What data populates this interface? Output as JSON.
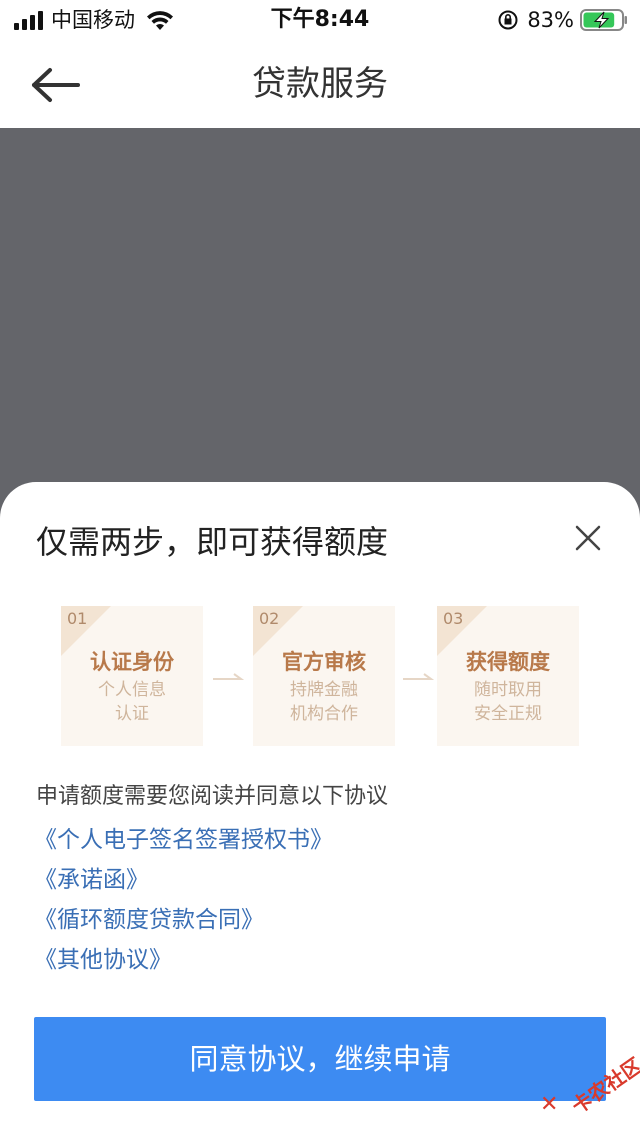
{
  "status_bar": {
    "carrier": "中国移动",
    "time": "下午8:44",
    "battery_percent": "83%",
    "battery_level": 0.83,
    "icons": [
      "signal-icon",
      "wifi-icon",
      "rotation-lock-icon",
      "battery-charging-icon"
    ]
  },
  "nav": {
    "title": "贷款服务",
    "back_icon": "back-arrow-icon"
  },
  "sheet": {
    "title": "仅需两步，即可获得额度",
    "close_icon": "close-icon",
    "steps": [
      {
        "num": "01",
        "title": "认证身份",
        "desc1": "个人信息",
        "desc2": "认证"
      },
      {
        "num": "02",
        "title": "官方审核",
        "desc1": "持牌金融",
        "desc2": "机构合作"
      },
      {
        "num": "03",
        "title": "获得额度",
        "desc1": "随时取用",
        "desc2": "安全正规"
      }
    ],
    "notice": "申请额度需要您阅读并同意以下协议",
    "agreements": [
      "《个人电子签名签署授权书》",
      "《承诺函》",
      "《循环额度贷款合同》",
      "《其他协议》"
    ],
    "cta_label": "同意协议，继续申请"
  },
  "watermark": {
    "text": "卡农社区"
  },
  "colors": {
    "backdrop": "#64656a",
    "accent": "#3d8bf2",
    "link": "#3a6fb5",
    "step_title": "#b8794a",
    "step_card": "#fbf6f0"
  }
}
